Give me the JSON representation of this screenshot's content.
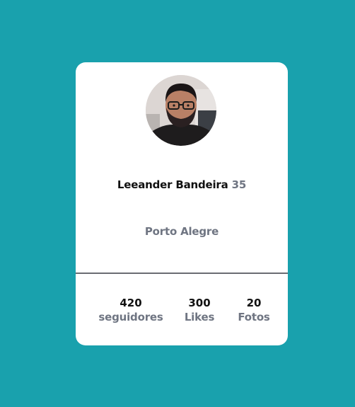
{
  "profile": {
    "name": "Leeander Bandeira",
    "age": "35",
    "location": "Porto Alegre",
    "avatar_icon": "user-photo"
  },
  "stats": {
    "followers": {
      "value": "420",
      "label": "seguidores"
    },
    "likes": {
      "value": "300",
      "label": "Likes"
    },
    "photos": {
      "value": "20",
      "label": "Fotos"
    }
  },
  "colors": {
    "background": "#19a1ad",
    "card": "#ffffff",
    "muted_text": "#6f7582",
    "primary_text": "#111111",
    "divider": "#6a6c72"
  }
}
